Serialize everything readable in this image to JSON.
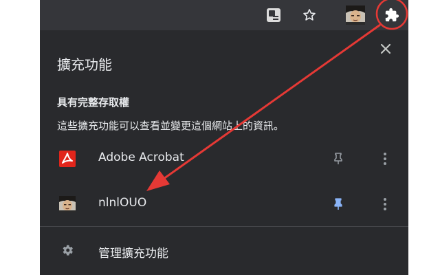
{
  "toolbar": {
    "icons": [
      "translate-icon",
      "star-icon",
      "profile-avatar",
      "extensions-puzzle-icon"
    ]
  },
  "panel": {
    "title": "擴充功能",
    "section_title": "具有完整存取權",
    "section_desc": "這些擴充功能可以查看並變更這個網站上的資訊。",
    "extensions": [
      {
        "name": "Adobe Acrobat",
        "icon": "adobe-acrobat-icon",
        "pinned": false
      },
      {
        "name": "nlnlOUO",
        "icon": "nlnlouo-avatar-icon",
        "pinned": true
      }
    ],
    "manage_label": "管理擴充功能"
  },
  "colors": {
    "panel_bg": "#292a2d",
    "toolbar_bg": "#35363a",
    "text": "#e8eaed",
    "icon_gray": "#9aa0a6",
    "pin_active": "#8ab4f8",
    "annotation_red": "#e53935",
    "adobe_red": "#e1251b"
  }
}
